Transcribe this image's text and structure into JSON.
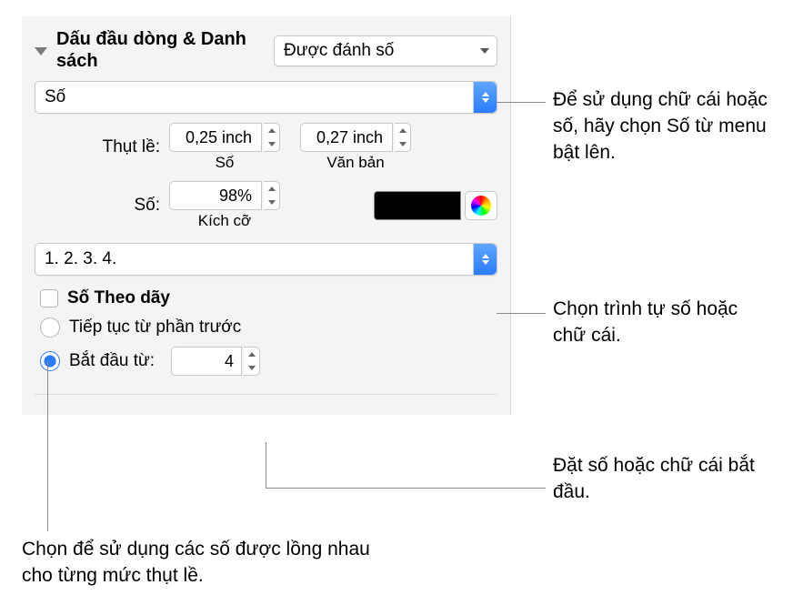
{
  "header": {
    "title": "Dấu đầu dòng & Danh sách",
    "style_popup": "Được đánh số"
  },
  "type_popup": "Số",
  "indent": {
    "label": "Thụt lề:",
    "number_value": "0,25 inch",
    "number_sublabel": "Số",
    "text_value": "0,27 inch",
    "text_sublabel": "Văn bản"
  },
  "size": {
    "label": "Số:",
    "value": "98%",
    "sublabel": "Kích cỡ"
  },
  "sequence_popup": "1. 2. 3. 4.",
  "tiered_checkbox_label": "Số Theo dãy",
  "continue_radio_label": "Tiếp tục từ phần trước",
  "start_radio_label": "Bắt đầu từ:",
  "start_value": "4",
  "callouts": {
    "type": "Để sử dụng chữ cái hoặc số, hãy chọn Số từ menu bật lên.",
    "sequence": "Chọn trình tự số hoặc chữ cái.",
    "start": "Đặt số hoặc chữ cái bắt đầu.",
    "tiered": "Chọn để sử dụng các số được lồng nhau cho từng mức thụt lề."
  }
}
